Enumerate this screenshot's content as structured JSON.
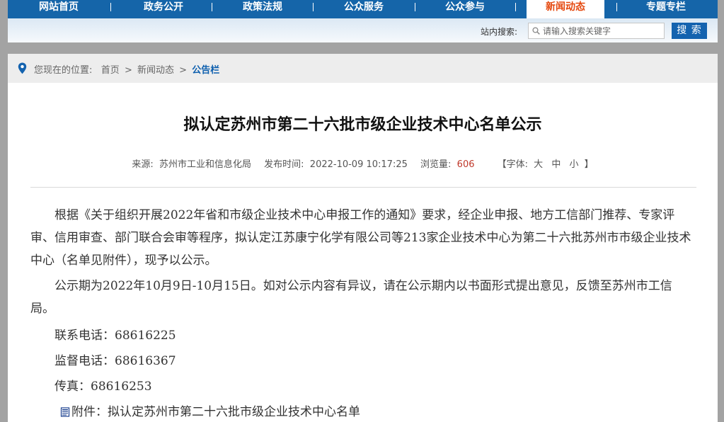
{
  "nav": {
    "items": [
      {
        "label": "网站首页",
        "active": false
      },
      {
        "label": "政务公开",
        "active": false
      },
      {
        "label": "政策法规",
        "active": false
      },
      {
        "label": "公众服务",
        "active": false
      },
      {
        "label": "公众参与",
        "active": false
      },
      {
        "label": "新闻动态",
        "active": true
      },
      {
        "label": "专题专栏",
        "active": false
      }
    ],
    "active_color": "#e5490f",
    "bar_color": "#1565a9"
  },
  "search": {
    "label": "站内搜索:",
    "placeholder": "请输入搜索关键字",
    "button_label": "搜 索",
    "icon": "search-icon"
  },
  "breadcrumb": {
    "prefix": "您现在的位置:",
    "items": [
      "首页",
      "新闻动态",
      "公告栏"
    ],
    "separator": ">",
    "icon": "location-pin-icon"
  },
  "article": {
    "title": "拟认定苏州市第二十六批市级企业技术中心名单公示",
    "meta": {
      "source_label": "来源:",
      "source": "苏州市工业和信息化局",
      "time_label": "发布时间:",
      "time": "2022-10-09 10:17:25",
      "views_label": "浏览量:",
      "views": "606",
      "font_open": "【字体:",
      "font_sizes": [
        "大",
        "中",
        "小"
      ],
      "font_close": "】"
    },
    "paragraphs": [
      "根据《关于组织开展2022年省和市级企业技术中心申报工作的通知》要求，经企业申报、地方工信部门推荐、专家评审、信用审查、部门联合会审等程序，拟认定江苏康宁化学有限公司等213家企业技术中心为第二十六批苏州市市级企业技术中心（名单见附件），现予以公示。",
      "公示期为2022年10月9日-10月15日。如对公示内容有异议，请在公示期内以书面形式提出意见，反馈至苏州市工信局。",
      "联系电话：68616225",
      "监督电话：68616367",
      "传真：68616253"
    ],
    "attachment": "附件：拟认定苏州市第二十六批市级企业技术中心名单",
    "attachment_icon": "document-icon"
  }
}
